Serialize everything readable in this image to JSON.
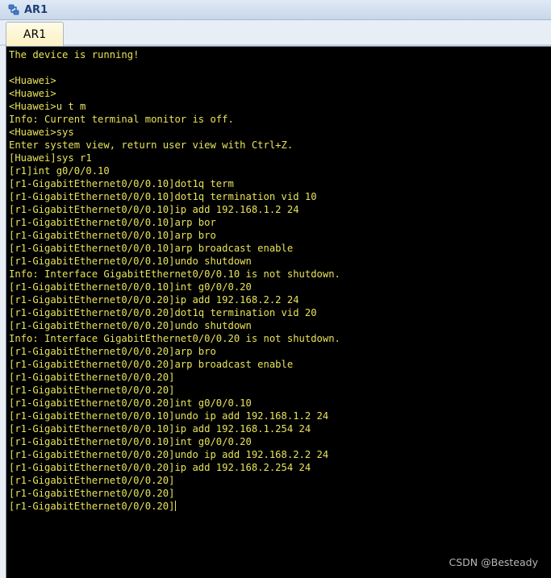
{
  "window": {
    "title": "AR1",
    "icon": "router-device-icon"
  },
  "tabs": [
    {
      "label": "AR1",
      "active": true
    }
  ],
  "terminal": {
    "text_color": "#e8e35a",
    "background": "#000000",
    "lines": [
      "The device is running!",
      "",
      "<Huawei>",
      "<Huawei>",
      "<Huawei>u t m",
      "Info: Current terminal monitor is off.",
      "<Huawei>sys",
      "Enter system view, return user view with Ctrl+Z.",
      "[Huawei]sys r1",
      "[r1]int g0/0/0.10",
      "[r1-GigabitEthernet0/0/0.10]dot1q term",
      "[r1-GigabitEthernet0/0/0.10]dot1q termination vid 10",
      "[r1-GigabitEthernet0/0/0.10]ip add 192.168.1.2 24",
      "[r1-GigabitEthernet0/0/0.10]arp bor",
      "[r1-GigabitEthernet0/0/0.10]arp bro",
      "[r1-GigabitEthernet0/0/0.10]arp broadcast enable",
      "[r1-GigabitEthernet0/0/0.10]undo shutdown",
      "Info: Interface GigabitEthernet0/0/0.10 is not shutdown.",
      "[r1-GigabitEthernet0/0/0.10]int g0/0/0.20",
      "[r1-GigabitEthernet0/0/0.20]ip add 192.168.2.2 24",
      "[r1-GigabitEthernet0/0/0.20]dot1q termination vid 20",
      "[r1-GigabitEthernet0/0/0.20]undo shutdown",
      "Info: Interface GigabitEthernet0/0/0.20 is not shutdown.",
      "[r1-GigabitEthernet0/0/0.20]arp bro",
      "[r1-GigabitEthernet0/0/0.20]arp broadcast enable",
      "[r1-GigabitEthernet0/0/0.20]",
      "[r1-GigabitEthernet0/0/0.20]",
      "[r1-GigabitEthernet0/0/0.20]int g0/0/0.10",
      "[r1-GigabitEthernet0/0/0.10]undo ip add 192.168.1.2 24",
      "[r1-GigabitEthernet0/0/0.10]ip add 192.168.1.254 24",
      "[r1-GigabitEthernet0/0/0.10]int g0/0/0.20",
      "[r1-GigabitEthernet0/0/0.20]undo ip add 192.168.2.2 24",
      "[r1-GigabitEthernet0/0/0.20]ip add 192.168.2.254 24",
      "[r1-GigabitEthernet0/0/0.20]",
      "[r1-GigabitEthernet0/0/0.20]",
      "[r1-GigabitEthernet0/0/0.20]"
    ]
  },
  "watermark": "CSDN @Besteady"
}
